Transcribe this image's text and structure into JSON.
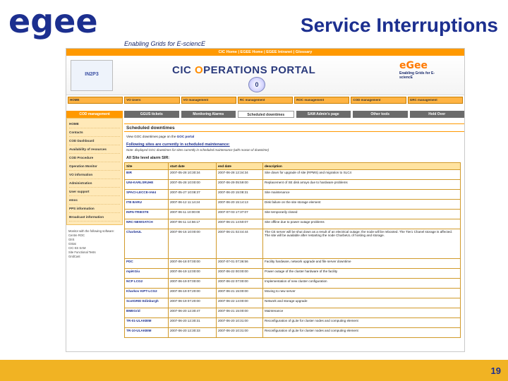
{
  "slide": {
    "logo_text": "egee",
    "tagline": "Enabling Grids for E-sciencE",
    "title": "Service Interruptions",
    "page_number": "19",
    "colors": {
      "title": "#1c2f8f",
      "logo": "#1c2f8f",
      "footer": "#f1b323"
    }
  },
  "portal": {
    "top_links": "CIC Home | EGEE Home | EGEE Intranet | Glossary",
    "banner_title_prefix": "CIC ",
    "banner_title_o": "O",
    "banner_title_rest": "PERATIONS PORTAL",
    "banner_logo_left": "IN2P3",
    "banner_egee_logo": "eGee",
    "banner_egee_sub": "Enabling Grids for E-sciencE",
    "main_nav": [
      "HOME",
      "VO Users",
      "VO management",
      "RC management",
      "ROC management",
      "COD management",
      "GRC management"
    ],
    "sidebar": {
      "head": "COD management",
      "items": [
        "HOME",
        "Contacts",
        "COD Dashboard",
        "Availability of resources",
        "COD Procedure",
        "Operation Monitor",
        "VO information",
        "Administration",
        "User support",
        "emoc",
        "PPS information",
        "Broadcast information"
      ],
      "small_links": [
        "Monitor with the following software:",
        "Centre ROC",
        "GIIS",
        "GStat",
        "CIC-SS SAM",
        "Site Functional Tests",
        "GridCast"
      ]
    },
    "subtabs": [
      "GGUS tickets",
      "Monitoring Alarms",
      "Scheduled downtimes",
      "SAM Admin's page",
      "Other tools",
      "Hold Over"
    ],
    "active_subtab_index": 2,
    "section_title": "Scheduled downtimes",
    "intro_prefix": "View GOC downtimes page on the ",
    "intro_link": "GOC portal",
    "following_text": "Following sites are currently in scheduled maintenance:",
    "note_text": "Note: displayed GOC downtimes for sites currently in scheduled maintenance (with reason of downtime)",
    "all_sites_heading": "All Site level alarm SIR:",
    "table": {
      "headers": [
        "Site",
        "start date",
        "end date",
        "description"
      ],
      "rows": [
        [
          "BIR",
          "2007-05-28 10:30:34",
          "2007-06-28 12:34:34",
          "Site down for upgrade of site (RPMS) and migration to SLC4"
        ],
        [
          "UNI-KARLSRUHE",
          "2007-05-28 10:00:00",
          "2007-06-29 05:59:00",
          "Replacement of SE disk arrays due to hardware problems"
        ],
        [
          "SPACI-LECCE-IA64",
          "2007-05-27 10:08:37",
          "2007-06-20 15:08:31",
          "Site maintenance"
        ],
        [
          "ITB BARU",
          "2007-06-12 11:14:24",
          "2007-06-20 15:14:13",
          "Disk failure on the site storage element"
        ],
        [
          "INFN-TRIESTE",
          "2007-06-11 10:00:00",
          "2007-07-03 17:37:07",
          "Site temporarily closed"
        ],
        [
          "NRC-NEWSATCH",
          "2007-06-11 14:56:17",
          "2007-06-21 14:50:07",
          "Site offline due to power outage problems"
        ],
        [
          "CharbeUL",
          "2007-06-16 10:00:00",
          "2007-06-21 02:44:44",
          "The CE server will be shut down as a result of an electrical outage; the node will be rebooted. The Tier1 Chanel storage is affected. The site will be available after restarting the node CharbeUL of hosting and storage."
        ],
        [
          "PDC",
          "2007-06-18 07:00:00",
          "2007-07-01 07:36:56",
          "Facility hardware, network upgrade and file server downtime"
        ],
        [
          "mpiKGiu",
          "2007-06-19 12:00:00",
          "2007-06-22 00:00:00",
          "Power outage of the cluster hardware of the facility"
        ],
        [
          "NCP LCG2",
          "2007-06-19 07:00:00",
          "2007-06-22 07:00:00",
          "Implementation of new cluster configuration"
        ],
        [
          "Kharkov KIPT-LCG2",
          "2007-06-19 07:20:00",
          "2007-06-21 15:00:00",
          "Moving to new server"
        ],
        [
          "ScotGRID Edinburgh",
          "2007-06-19 07:20:00",
          "2007-06-22 14:00:00",
          "Network and storage upgrade"
        ],
        [
          "BMEGrid",
          "2007-06-20 12:30:47",
          "2007-06-21 15:00:00",
          "Maintenance"
        ],
        [
          "TR-01-ULAKBIM",
          "2007-06-20 12:30:31",
          "2007-06-20 10:31:00",
          "Reconfiguration of gLite for cluster nodes and computing element"
        ],
        [
          "TR-10-ULAKBIM",
          "2007-06-20 12:30:33",
          "2007-06-20 10:31:00",
          "Reconfiguration of gLite for cluster nodes and computing element"
        ]
      ]
    }
  }
}
